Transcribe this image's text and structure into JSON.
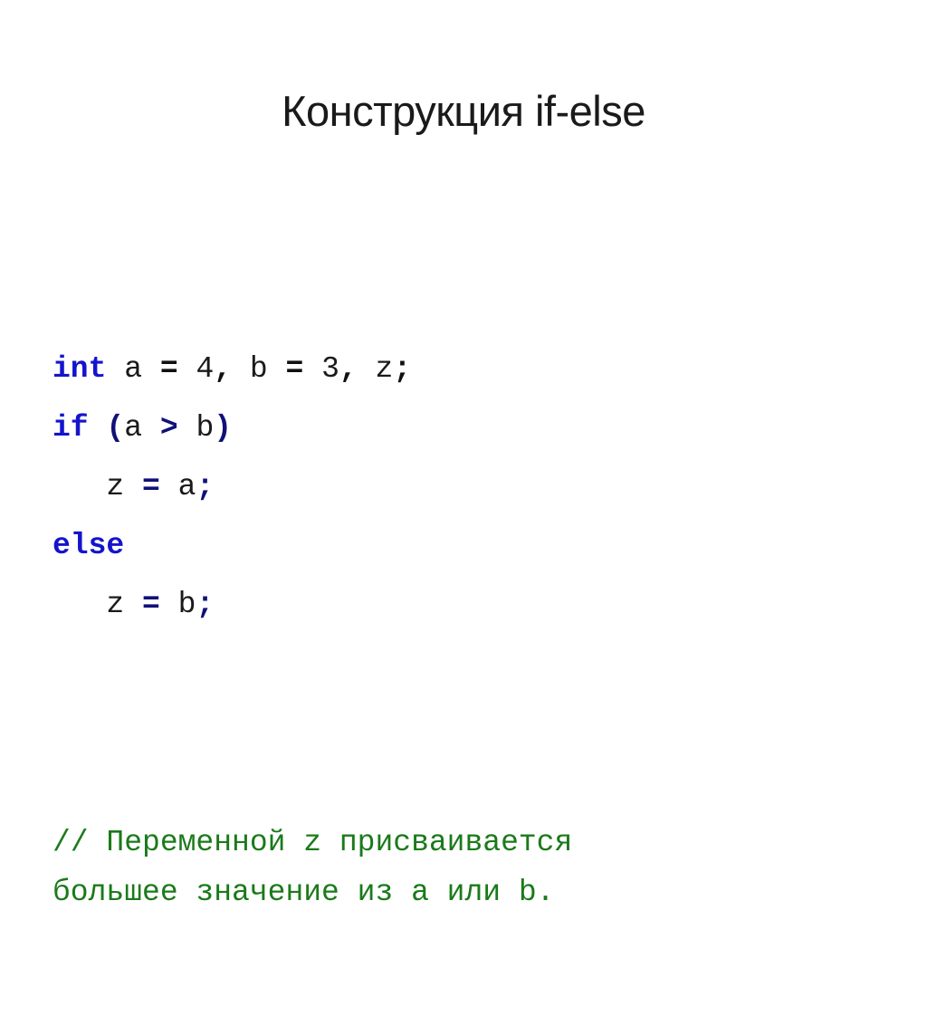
{
  "slide": {
    "title": "Конструкция if-else",
    "background_color": "#ffffff"
  },
  "colors": {
    "title_text": "#1a1a1a",
    "keyword_blue": "#1414cd",
    "operator_navy": "#10107a",
    "plain_text": "#1a1a1a",
    "comment_green": "#1a7a1a"
  },
  "code": {
    "language": "c",
    "full_text": "int a = 4, b = 3, z;\nif (a > b)\n    z = a;\nelse\n    z = b;\n// Переменной z присваивается\nбольшее значение из a или b.",
    "lines": [
      {
        "indent": "",
        "tokens": [
          {
            "text": "int",
            "kind": "keyword"
          },
          {
            "text": " a ",
            "kind": "plain"
          },
          {
            "text": "=",
            "kind": "punct-dark"
          },
          {
            "text": " 4",
            "kind": "plain"
          },
          {
            "text": ",",
            "kind": "punct-dark"
          },
          {
            "text": " b ",
            "kind": "plain"
          },
          {
            "text": "=",
            "kind": "punct-dark"
          },
          {
            "text": " 3",
            "kind": "plain"
          },
          {
            "text": ",",
            "kind": "punct-dark"
          },
          {
            "text": " z",
            "kind": "plain"
          },
          {
            "text": ";",
            "kind": "punct-dark"
          }
        ]
      },
      {
        "indent": "",
        "tokens": [
          {
            "text": "if",
            "kind": "keyword"
          },
          {
            "text": " ",
            "kind": "plain"
          },
          {
            "text": "(",
            "kind": "punct"
          },
          {
            "text": "a ",
            "kind": "plain"
          },
          {
            "text": ">",
            "kind": "operator"
          },
          {
            "text": " b",
            "kind": "plain"
          },
          {
            "text": ")",
            "kind": "punct"
          }
        ]
      },
      {
        "indent": "   ",
        "tokens": [
          {
            "text": "z ",
            "kind": "plain"
          },
          {
            "text": "=",
            "kind": "operator"
          },
          {
            "text": " a",
            "kind": "plain"
          },
          {
            "text": ";",
            "kind": "punct"
          }
        ]
      },
      {
        "indent": "",
        "tokens": [
          {
            "text": "else",
            "kind": "keyword"
          }
        ]
      },
      {
        "indent": "   ",
        "tokens": [
          {
            "text": "z ",
            "kind": "plain"
          },
          {
            "text": "=",
            "kind": "operator"
          },
          {
            "text": " b",
            "kind": "plain"
          },
          {
            "text": ";",
            "kind": "punct"
          }
        ]
      }
    ],
    "comment_lines": [
      "// Переменной z присваивается",
      "большее значение из a или b."
    ]
  }
}
